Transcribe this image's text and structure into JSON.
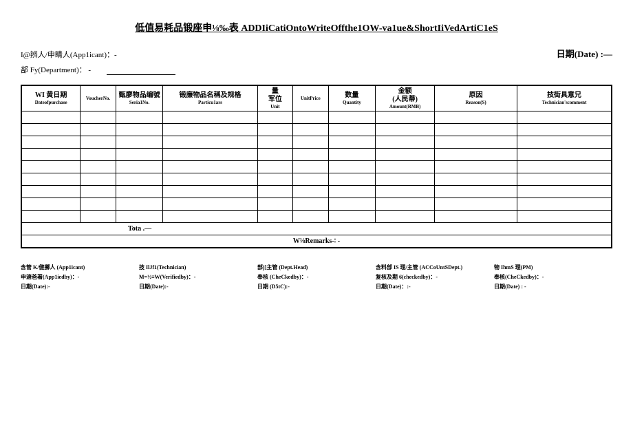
{
  "title": "低值易耗品锻座申⅛‰表 ADDIiCatiOntoWriteOffthe1OW-va1ue&ShortIiVedArtiC1eS",
  "header": {
    "applicant_label": "I@辨人/申睛人(App1icant)：-",
    "date_label": "日期(Date) :—",
    "dept_label": "部 Fy(Department)： -"
  },
  "columns": [
    {
      "top": "WI 黄日期",
      "sub": "Dateofpurchase"
    },
    {
      "top": "",
      "sub": "VoucherNo."
    },
    {
      "top": "甄廖物品编號",
      "sub": "Seria1No."
    },
    {
      "top": "锻廉物品名稱及规格",
      "sub": "Particu1ars"
    },
    {
      "top": "量\n军位",
      "sub": "Unit"
    },
    {
      "top": "",
      "sub": "UnitPrice"
    },
    {
      "top": "数量",
      "sub": "Quantity"
    },
    {
      "top": "金额\n(人民蒂)",
      "sub": "Amount(RMB)"
    },
    {
      "top": "原因",
      "sub": "Reason(S)"
    },
    {
      "top": "技街具意兄",
      "sub": "Technician'scomment"
    }
  ],
  "total_label": "Tota  .—",
  "remarks_label": "W⅛Remarks-∶ -",
  "signatures": [
    {
      "role": "含管 K/健擲人 (App1icant)",
      "sign": "申溏爸署(App1iedby)：-",
      "date": "日期(Date):-"
    },
    {
      "role": "技 IlJf1(Technician)",
      "sign": "M=½≡W(Verifiedby)：-",
      "date": "日期(Date):-"
    },
    {
      "role": "部j]主管 (Dept.Head)",
      "sign": "奉核 (CheCkedby)：-",
      "date": "日期 (D5tC):-"
    },
    {
      "role": "含料部 IS 理/主管 (ACCoUntSDept.)",
      "sign": "复核及期 6(checkedby)：-",
      "date": "日期(Date)：:-"
    },
    {
      "role": "物 IhmS 理(PM)",
      "sign": "奉核(CheCkedby)：-",
      "date": "日期(Date) : -"
    }
  ]
}
